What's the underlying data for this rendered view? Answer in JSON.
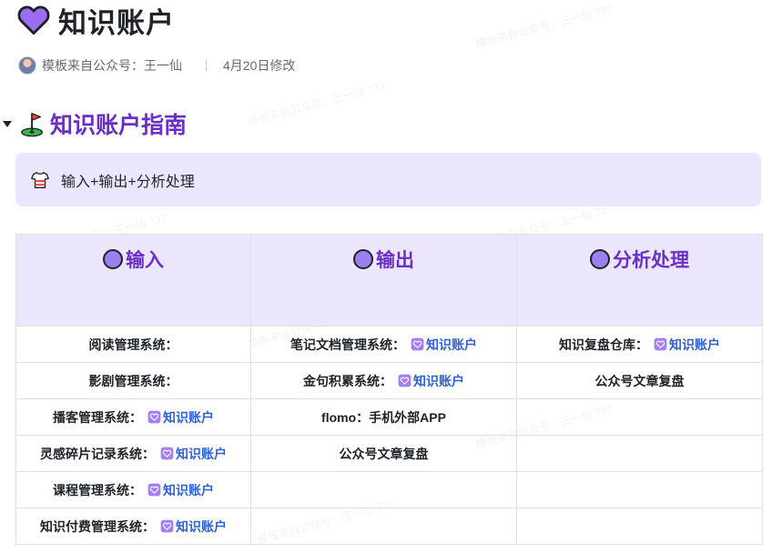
{
  "page": {
    "title": "知识账户",
    "meta": {
      "author": "模板来自公众号：王一仙",
      "modified": "4月20日修改"
    }
  },
  "section": {
    "title": "知识账户指南"
  },
  "callout": {
    "text": "输入+输出+分析处理"
  },
  "table": {
    "headers": [
      "输入",
      "输出",
      "分析处理"
    ],
    "rows": [
      [
        {
          "text": "阅读管理系统："
        },
        {
          "text": "笔记文档管理系统：",
          "link": "知识账户"
        },
        {
          "text": "知识复盘仓库：",
          "link": "知识账户"
        }
      ],
      [
        {
          "text": "影剧管理系统："
        },
        {
          "text": "金句积累系统：",
          "link": "知识账户"
        },
        {
          "text": "公众号文章复盘"
        }
      ],
      [
        {
          "text": "播客管理系统：",
          "link": "知识账户"
        },
        {
          "text": "flomo：手机外部APP"
        },
        {
          "text": ""
        }
      ],
      [
        {
          "text": "灵感碎片记录系统：",
          "link": "知识账户"
        },
        {
          "text": "公众号文章复盘"
        },
        {
          "text": ""
        }
      ],
      [
        {
          "text": "课程管理系统：",
          "link": "知识账户"
        },
        {
          "text": ""
        },
        {
          "text": ""
        }
      ],
      [
        {
          "text": "知识付费管理系统：",
          "link": "知识账户"
        },
        {
          "text": ""
        },
        {
          "text": ""
        }
      ]
    ]
  },
  "watermark": "模板来自公众号：王一仙 737",
  "colors": {
    "accent": "#6c2ec9",
    "callout_bg": "#ece6fd",
    "link": "#2e62d9",
    "heart": "#9b6df0"
  },
  "icons": {
    "title": "purple-heart-icon",
    "section": "golf-flag-icon",
    "callout": "shirt-icon",
    "header": "purple-circle-icon",
    "link": "purple-heart-icon"
  }
}
